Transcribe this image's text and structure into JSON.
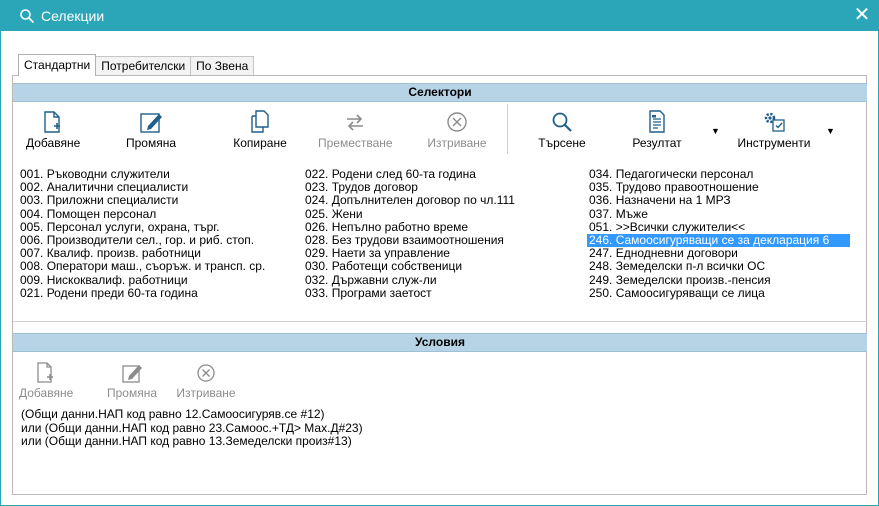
{
  "window": {
    "title": "Селекции",
    "close_glyph": "✕"
  },
  "tabs": [
    "Стандартни",
    "Потребителски",
    "По Звена"
  ],
  "selectors": {
    "header": "Селектори",
    "toolbar": {
      "add": "Добавяне",
      "edit": "Промяна",
      "copy": "Копиране",
      "move": "Преместване",
      "delete": "Изтриване",
      "search": "Търсене",
      "result": "Резултат",
      "tools": "Инструменти"
    },
    "col1": [
      "001. Ръководни служители",
      "002. Аналитични специалисти",
      "003. Приложни специалисти",
      "004. Помощен персонал",
      "005. Персонал услуги, охрана, търг.",
      "006. Производители сел., гор. и риб. стоп.",
      "007. Квалиф. произв. работници",
      "008. Оператори маш., съоръж. и трансп. ср.",
      "009. Нискоквалиф. работници",
      "021. Родени преди 60-та година"
    ],
    "col2": [
      "022. Родени след 60-та година",
      "023. Трудов договор",
      "024. Допълнителен  договор по чл.111",
      "025. Жени",
      "026. Непълно работно време",
      "028. Без трудови взаимоотношения",
      "029. Наети за управление",
      "030. Работещи собственици",
      "032. Държавни служ-ли",
      "033. Програми заетост"
    ],
    "col3": [
      "034. Педагогически персонал",
      "035. Трудово правоотношение",
      "036. Назначени на 1 МРЗ",
      "037. Мъже",
      "051. >>Всички служители<<",
      "246. Самоосигуряващи се за декларация 6",
      "247. Еднодневни договори",
      "248. Земеделски п-л всички ОС",
      "249. Земеделски произв.-пенсия",
      "250. Самоосигуряващи се лица"
    ],
    "selected": "246. Самоосигуряващи се за декларация 6"
  },
  "conditions": {
    "header": "Условия",
    "toolbar": {
      "add": "Добавяне",
      "edit": "Промяна",
      "delete": "Изтриване"
    },
    "lines": [
      " (Общи данни.НАП код равно 12.Самоосигуряв.се #12)",
      "или (Общи данни.НАП код равно 23.Самоос.+ТД> Мах.Д#23)",
      "или (Общи данни.НАП код равно 13.Земеделски произ#13)"
    ]
  },
  "colors": {
    "titlebar": "#2aa6b8",
    "section_header": "#b7d4e6",
    "selection": "#3399ff",
    "icon_blue": "#1f5f8b",
    "disabled": "#8c8c8c"
  }
}
